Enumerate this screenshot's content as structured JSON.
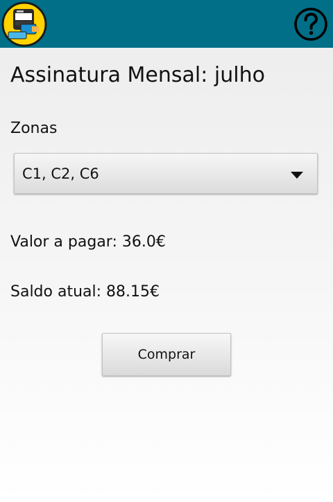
{
  "app": {
    "logo_icon": "ticket-machine-logo-icon",
    "help_icon": "question-circle-icon",
    "bar_color": "#006f87"
  },
  "page": {
    "title": "Assinatura Mensal: julho"
  },
  "zones": {
    "label": "Zonas",
    "selected": "C1, C2, C6"
  },
  "payment": {
    "amount_label": "Valor a pagar:",
    "amount_value": "36.0€",
    "balance_label": "Saldo atual:",
    "balance_value": "88.15€"
  },
  "actions": {
    "buy_label": "Comprar"
  }
}
